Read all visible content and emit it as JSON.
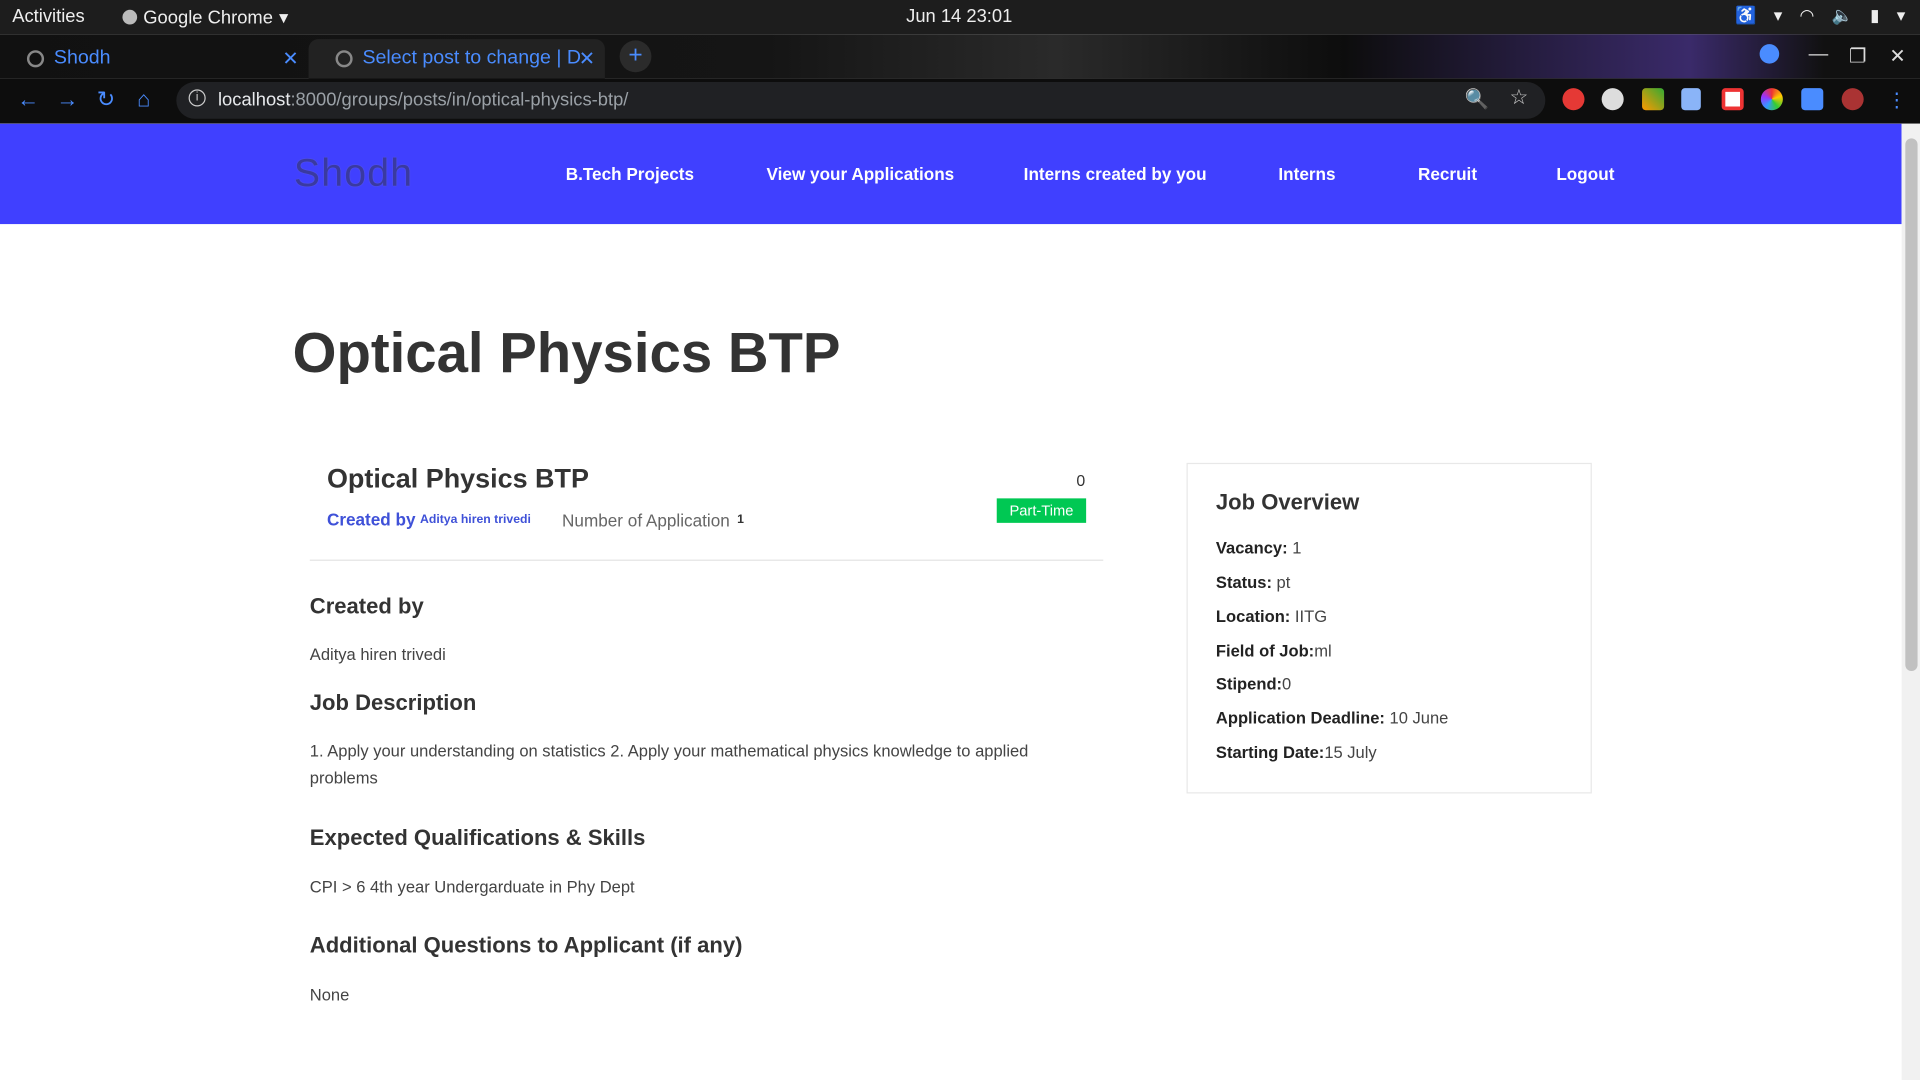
{
  "system": {
    "activities": "Activities",
    "app_name": "Google Chrome",
    "clock": "Jun 14  23:01"
  },
  "browser": {
    "tabs": [
      {
        "label": "Shodh"
      },
      {
        "label": "Select post to change | Dj"
      }
    ],
    "url_host": "localhost",
    "url_path": ":8000/groups/posts/in/optical-physics-btp/"
  },
  "site": {
    "logo": "Shodh",
    "nav": [
      "B.Tech Projects",
      "View your Applications",
      "Interns created by you",
      "Interns",
      "Recruit",
      "Logout"
    ]
  },
  "main": {
    "page_title": "Optical Physics BTP",
    "card": {
      "title": "Optical Physics BTP",
      "created_by_label": "Created by",
      "created_by_name": "Aditya hiren trivedi",
      "num_app_label": "Number of Application",
      "num_app_value": "1",
      "count": "0",
      "badge": "Part-Time"
    },
    "sections": [
      {
        "heading": "Created by",
        "body": "Aditya hiren trivedi"
      },
      {
        "heading": "Job Description",
        "body": "1. Apply your understanding on statistics 2. Apply your mathematical physics knowledge to applied problems"
      },
      {
        "heading": "Expected Qualifications & Skills",
        "body": "CPI > 6 4th year Undergarduate in Phy Dept"
      },
      {
        "heading": "Additional Questions to Applicant (if any)",
        "body": "None"
      }
    ]
  },
  "overview": {
    "heading": "Job Overview",
    "rows": [
      {
        "label": "Vacancy:",
        "value": " 1"
      },
      {
        "label": "Status:",
        "value": " pt"
      },
      {
        "label": "Location:",
        "value": " IITG"
      },
      {
        "label": "Field of Job:",
        "value": "ml"
      },
      {
        "label": "Stipend:",
        "value": "0"
      },
      {
        "label": "Application Deadline:",
        "value": " 10 June"
      },
      {
        "label": "Starting Date:",
        "value": "15 July"
      }
    ]
  },
  "colors": {
    "nav_bg": "#4040ff",
    "badge_bg": "#00c853",
    "link": "#3f51d8"
  }
}
